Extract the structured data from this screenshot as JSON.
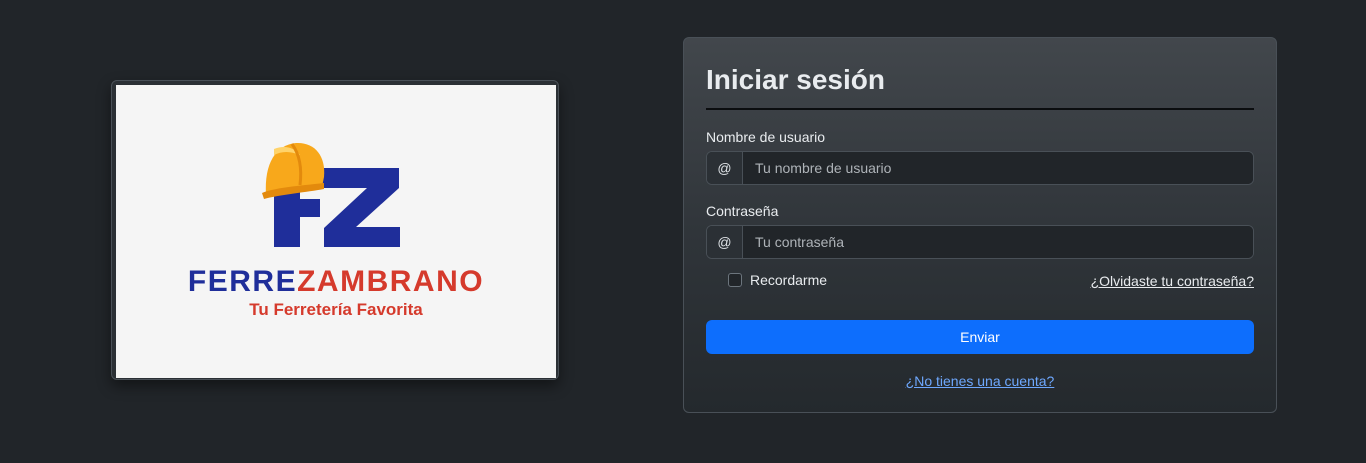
{
  "logo": {
    "monogram": "FZ",
    "brand_part1": "FERRE",
    "brand_part2": "ZAMBRANO",
    "tagline": "Tu Ferretería Favorita",
    "colors": {
      "blue": "#1f2e9a",
      "red": "#d53a2c",
      "helmet": "#f8a81b",
      "background": "#f5f5f5"
    }
  },
  "login": {
    "title": "Iniciar sesión",
    "username": {
      "label": "Nombre de usuario",
      "addon": "@",
      "placeholder": "Tu nombre de usuario",
      "value": ""
    },
    "password": {
      "label": "Contraseña",
      "addon": "@",
      "placeholder": "Tu contraseña",
      "value": ""
    },
    "remember_label": "Recordarme",
    "remember_checked": false,
    "forgot_link": "¿Olvidaste tu contraseña?",
    "submit_label": "Enviar",
    "register_link": "¿No tienes una cuenta?"
  },
  "colors": {
    "page_background": "#212529",
    "primary": "#0d6efd",
    "link": "#6ea8fe"
  }
}
